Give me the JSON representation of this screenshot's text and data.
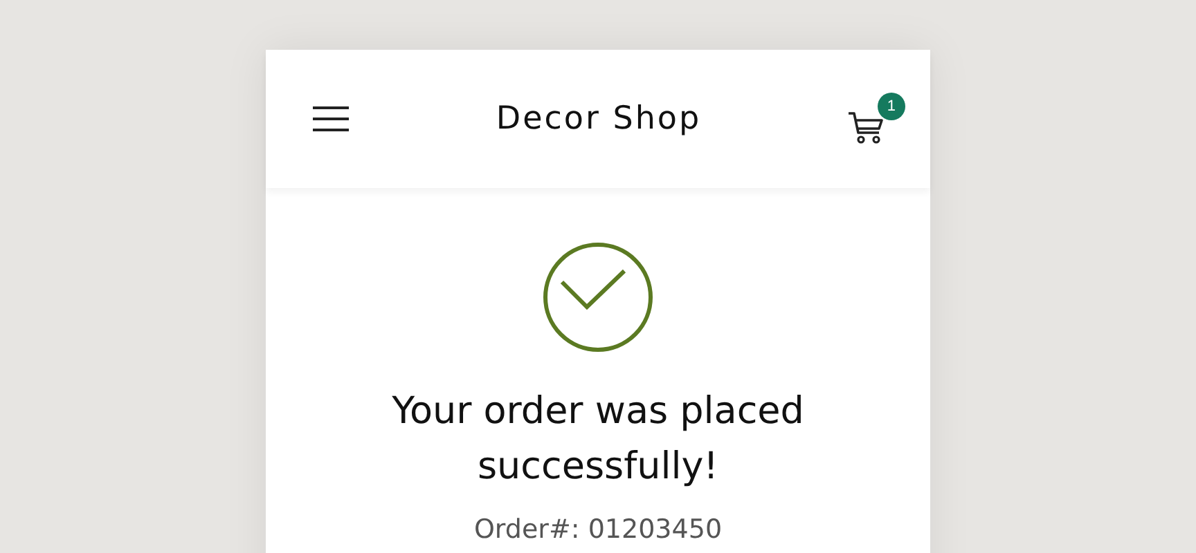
{
  "header": {
    "title": "Decor Shop",
    "cart_count": "1"
  },
  "confirmation": {
    "message": "Your order was placed successfully!",
    "order_number": "Order#: 01203450"
  }
}
